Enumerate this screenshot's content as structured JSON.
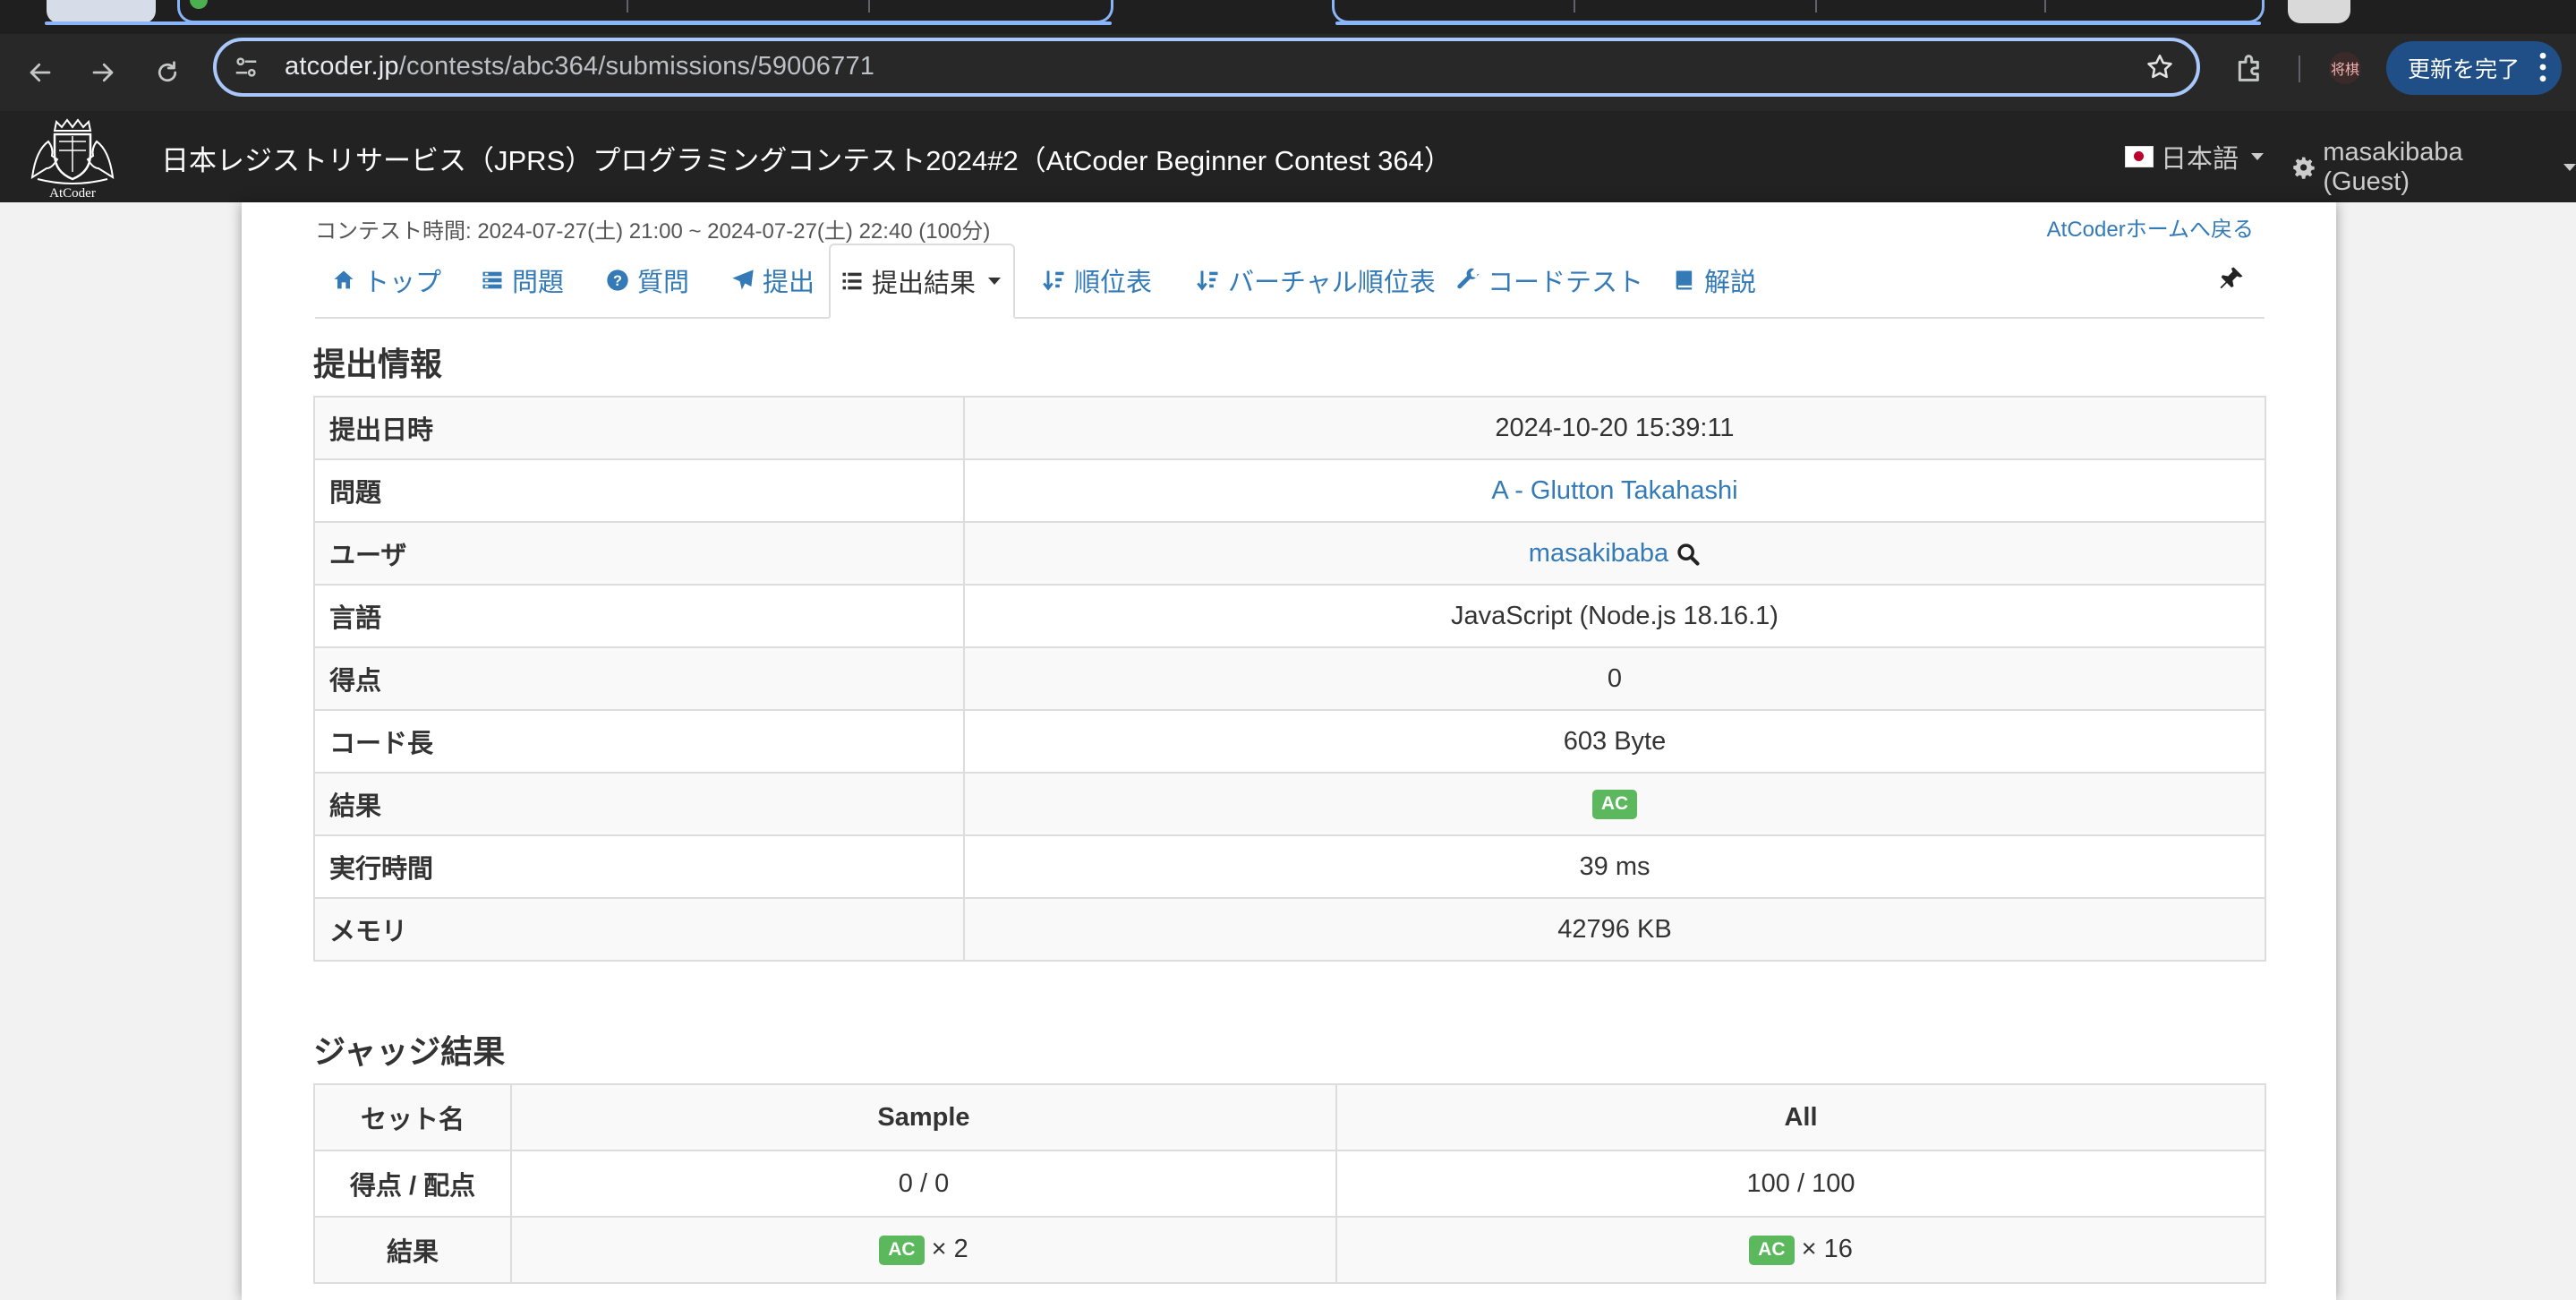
{
  "browser": {
    "url_host": "atcoder.jp",
    "url_path": "/contests/abc364/submissions/59006771",
    "update_button": "更新を完了",
    "extension_badge": "将棋"
  },
  "navbar": {
    "contest_title": "日本レジストリサービス（JPRS）プログラミングコンテスト2024#2（AtCoder Beginner Contest 364）",
    "language": "日本語",
    "user": "masakibaba (Guest)",
    "logo_text": "AtCoder"
  },
  "contest": {
    "time": "コンテスト時間: 2024-07-27(土) 21:00 ~ 2024-07-27(土) 22:40 (100分)",
    "home_link": "AtCoderホームへ戻る"
  },
  "tabs": [
    {
      "label": "トップ",
      "icon": "home-icon"
    },
    {
      "label": "問題",
      "icon": "tasks-icon"
    },
    {
      "label": "質問",
      "icon": "question-icon"
    },
    {
      "label": "提出",
      "icon": "send-icon"
    },
    {
      "label": "提出結果",
      "icon": "list-icon"
    },
    {
      "label": "順位表",
      "icon": "sort-icon"
    },
    {
      "label": "バーチャル順位表",
      "icon": "sort-icon"
    },
    {
      "label": "コードテスト",
      "icon": "wrench-icon"
    },
    {
      "label": "解説",
      "icon": "book-icon"
    }
  ],
  "submission": {
    "heading": "提出情報",
    "rows": [
      {
        "label": "提出日時",
        "value": "2024-10-20 15:39:11"
      },
      {
        "label": "問題",
        "value": "A - Glutton Takahashi"
      },
      {
        "label": "ユーザ",
        "value": "masakibaba"
      },
      {
        "label": "言語",
        "value": "JavaScript (Node.js 18.16.1)"
      },
      {
        "label": "得点",
        "value": "0"
      },
      {
        "label": "コード長",
        "value": "603 Byte"
      },
      {
        "label": "結果",
        "value": "AC"
      },
      {
        "label": "実行時間",
        "value": "39 ms"
      },
      {
        "label": "メモリ",
        "value": "42796 KB"
      }
    ]
  },
  "judge": {
    "heading": "ジャッジ結果",
    "headers": [
      "セット名",
      "Sample",
      "All"
    ],
    "score_label": "得点 / 配点",
    "scores": [
      "0 / 0",
      "100 / 100"
    ],
    "result_label": "結果",
    "results": [
      {
        "status": "AC",
        "count": "× 2"
      },
      {
        "status": "AC",
        "count": "× 16"
      }
    ]
  },
  "colors": {
    "link": "#337ab7",
    "ac_label": "#5cb85c",
    "navbar": "#222222",
    "omnibox_border": "#a8c7fa"
  }
}
